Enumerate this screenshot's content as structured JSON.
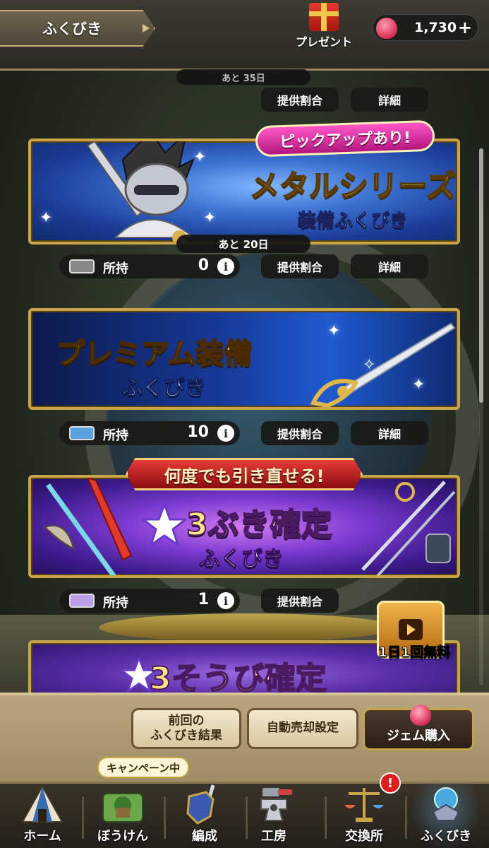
{
  "header": {
    "title": "ふくびき",
    "present_label": "プレゼント",
    "gem_count": "1,730",
    "gem_plus": "+"
  },
  "top_row": {
    "days_left": "あと 35日",
    "rates_button": "提供割合",
    "details_button": "詳細"
  },
  "banners": [
    {
      "pickup_badge": "ピックアップあり!",
      "title_line1": "メタルシリーズ",
      "title_line2": "装備ふくびき",
      "days_left": "あと 20日",
      "owned_label": "所持",
      "owned_count": "0",
      "rates_button": "提供割合",
      "details_button": "詳細"
    },
    {
      "title_line1": "プレミアム装備",
      "title_line2": "ふくびき",
      "owned_label": "所持",
      "owned_count": "10",
      "rates_button": "提供割合",
      "details_button": "詳細"
    },
    {
      "ribbon": "何度でも引き直せる!",
      "title_line1": "3ぶき確定",
      "title_line2": "ふくびき",
      "owned_label": "所持",
      "owned_count": "1",
      "rates_button": "提供割合"
    },
    {
      "title_line1": "3そうび確定",
      "free_label": "1日1回無料"
    }
  ],
  "actions": {
    "previous_results": "前回の\nふくびき結果",
    "auto_sell": "自動売却設定",
    "gem_purchase": "ジェム購入"
  },
  "nav": {
    "campaign_tag": "キャンペーン中",
    "notification": "!",
    "items": [
      {
        "label": "ホーム",
        "icon": "tent-icon"
      },
      {
        "label": "ぼうけん",
        "icon": "adventure-map-icon"
      },
      {
        "label": "編成",
        "icon": "shield-sword-icon"
      },
      {
        "label": "工房",
        "icon": "anvil-icon"
      },
      {
        "label": "交換所",
        "icon": "scales-icon"
      },
      {
        "label": "ふくびき",
        "icon": "gacha-orb-icon"
      }
    ]
  },
  "colors": {
    "gold_border": "#c8a548",
    "gem_pink": "#e03d62",
    "topbar_bg": "#3b3a33",
    "actionbar_bg": "#b8a57e"
  }
}
